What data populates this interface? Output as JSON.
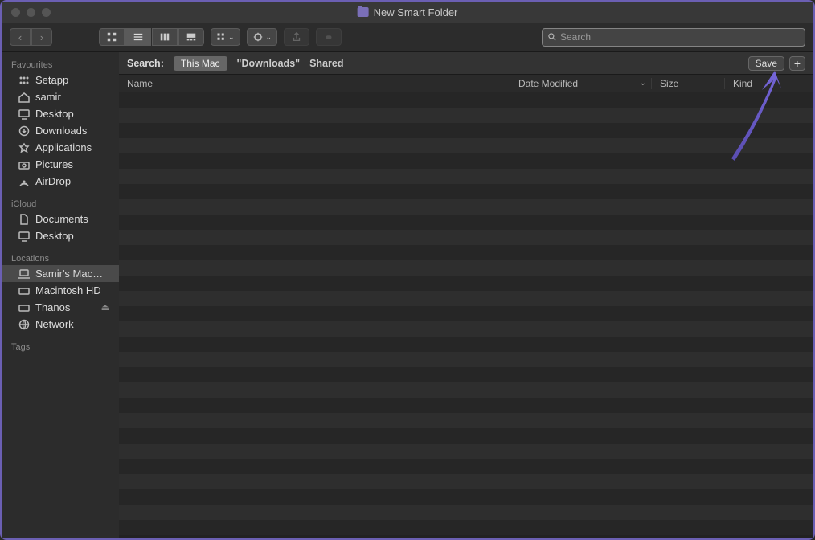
{
  "window": {
    "title": "New Smart Folder"
  },
  "search": {
    "placeholder": "Search"
  },
  "sidebar": {
    "sections": [
      {
        "title": "Favourites",
        "items": [
          {
            "label": "Setapp",
            "icon": "grid"
          },
          {
            "label": "samir",
            "icon": "home"
          },
          {
            "label": "Desktop",
            "icon": "desktop"
          },
          {
            "label": "Downloads",
            "icon": "download"
          },
          {
            "label": "Applications",
            "icon": "apps"
          },
          {
            "label": "Pictures",
            "icon": "camera"
          },
          {
            "label": "AirDrop",
            "icon": "airdrop"
          }
        ]
      },
      {
        "title": "iCloud",
        "items": [
          {
            "label": "Documents",
            "icon": "doc"
          },
          {
            "label": "Desktop",
            "icon": "desktop"
          }
        ]
      },
      {
        "title": "Locations",
        "items": [
          {
            "label": "Samir's Mac…",
            "icon": "laptop",
            "selected": true
          },
          {
            "label": "Macintosh HD",
            "icon": "disk"
          },
          {
            "label": "Thanos",
            "icon": "disk",
            "eject": true
          },
          {
            "label": "Network",
            "icon": "network"
          }
        ]
      },
      {
        "title": "Tags",
        "items": []
      }
    ]
  },
  "searchbar": {
    "label": "Search:",
    "scope_selected": "This Mac",
    "scope_downloads": "\"Downloads\"",
    "scope_shared": "Shared",
    "save": "Save"
  },
  "columns": {
    "name": "Name",
    "date": "Date Modified",
    "size": "Size",
    "kind": "Kind"
  }
}
